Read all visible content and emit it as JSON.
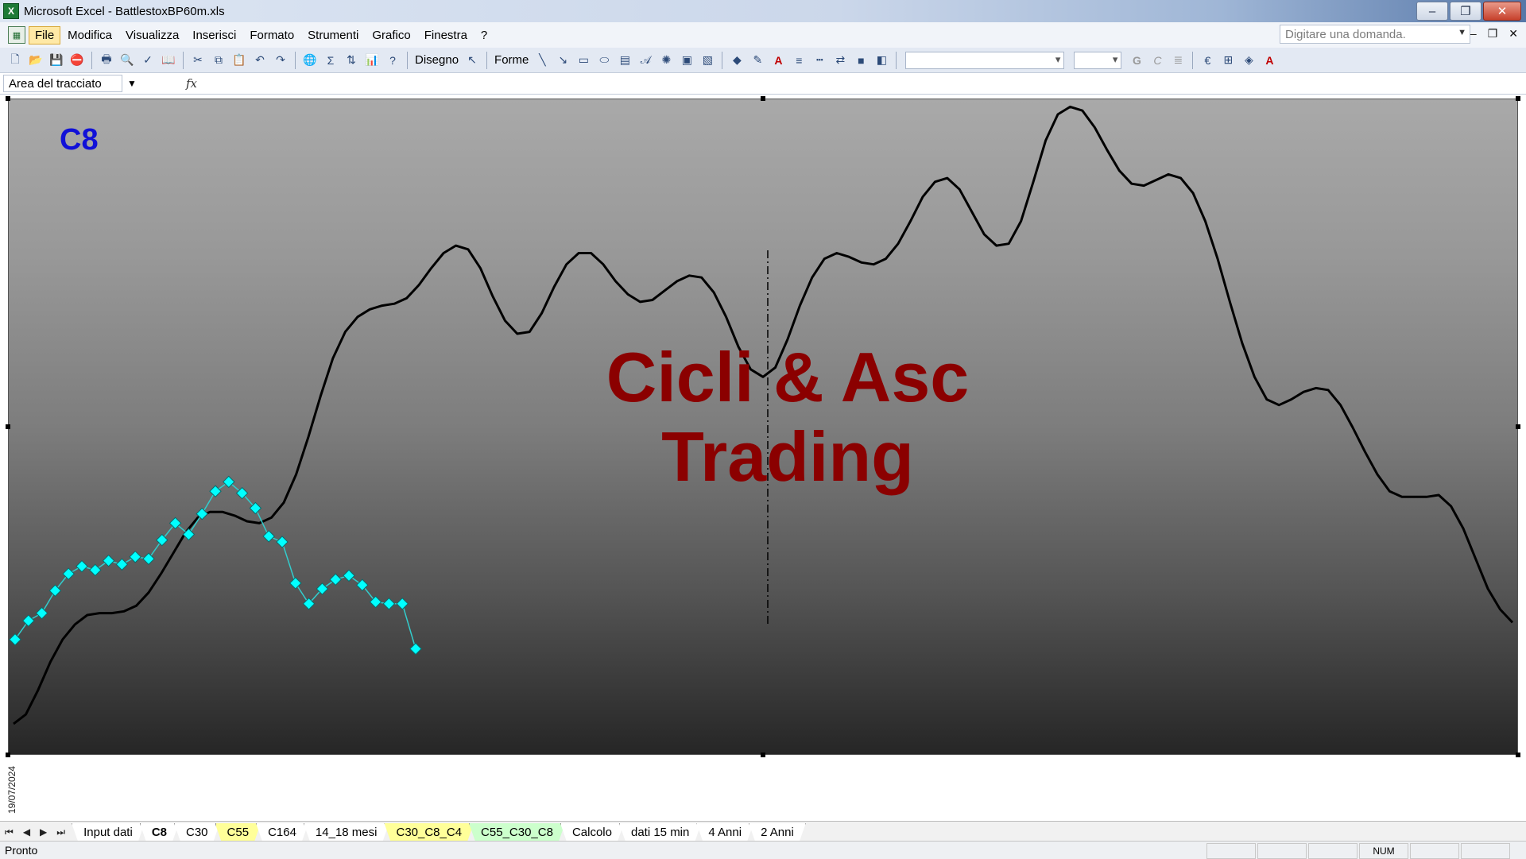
{
  "window": {
    "title": "Microsoft Excel - BattlestoxBP60m.xls",
    "app_icon": "X",
    "minimize": "–",
    "restore": "❐",
    "close": "✕"
  },
  "menu": {
    "items": [
      "File",
      "Modifica",
      "Visualizza",
      "Inserisci",
      "Formato",
      "Strumenti",
      "Grafico",
      "Finestra",
      "?"
    ],
    "help_placeholder": "Digitare una domanda."
  },
  "toolbar": {
    "draw_label": "Disegno",
    "shapes_label": "Forme"
  },
  "namebox": {
    "value": "Area del tracciato",
    "fx": "fx"
  },
  "chart": {
    "label": "C8",
    "watermark_line1": "Cicli & Asc",
    "watermark_line2": "Trading",
    "date_label": "19/07/2024",
    "colors": {
      "price_line": "#000000",
      "cycle_line": "#33cccc",
      "cycle_marker": "#00ffff",
      "label": "#1010d8",
      "watermark": "#8b0000"
    }
  },
  "chart_data": {
    "type": "line",
    "series": [
      {
        "values": [
          17,
          22,
          35,
          50,
          62,
          70,
          75,
          76,
          76,
          77,
          80,
          87,
          97,
          108,
          119,
          127,
          130,
          130,
          128,
          125,
          124,
          127,
          135,
          150,
          170,
          192,
          212,
          226,
          234,
          238,
          240,
          241,
          244,
          251,
          260,
          268,
          272,
          270,
          260,
          245,
          232,
          225,
          226,
          236,
          250,
          262,
          268,
          268,
          262,
          253,
          246,
          242,
          243,
          248,
          253,
          256,
          255,
          247,
          234,
          218,
          206,
          202,
          207,
          222,
          240,
          255,
          265,
          268,
          266,
          263,
          262,
          265,
          273,
          285,
          298,
          306,
          308,
          302,
          290,
          278,
          272,
          273,
          285,
          306,
          328,
          342,
          346,
          344,
          335,
          323,
          312,
          305,
          304,
          307,
          310,
          308,
          300,
          285,
          265,
          242,
          220,
          202,
          190,
          187,
          190,
          194,
          196,
          195,
          187,
          175,
          162,
          150,
          141,
          138,
          138,
          138,
          139,
          133,
          121,
          105,
          89,
          78,
          71
        ]
      },
      {
        "values": [
          62,
          72,
          76,
          88,
          97,
          101,
          99,
          104,
          102,
          106,
          105,
          115,
          124,
          118,
          129,
          141,
          146,
          140,
          132,
          117,
          114,
          92,
          81,
          89,
          94,
          96,
          91,
          82,
          81,
          81,
          57
        ]
      }
    ]
  },
  "sheet_tabs": [
    {
      "label": "Input dati",
      "style": "normal"
    },
    {
      "label": "C8",
      "style": "active"
    },
    {
      "label": "C30",
      "style": "normal"
    },
    {
      "label": "C55",
      "style": "yellow"
    },
    {
      "label": "C164",
      "style": "normal"
    },
    {
      "label": "14_18 mesi",
      "style": "normal"
    },
    {
      "label": "C30_C8_C4",
      "style": "yellow"
    },
    {
      "label": "C55_C30_C8",
      "style": "green"
    },
    {
      "label": "Calcolo",
      "style": "normal"
    },
    {
      "label": "dati 15 min",
      "style": "normal"
    },
    {
      "label": "4 Anni",
      "style": "normal"
    },
    {
      "label": "2 Anni",
      "style": "normal"
    }
  ],
  "status": {
    "text": "Pronto",
    "num": "NUM"
  }
}
